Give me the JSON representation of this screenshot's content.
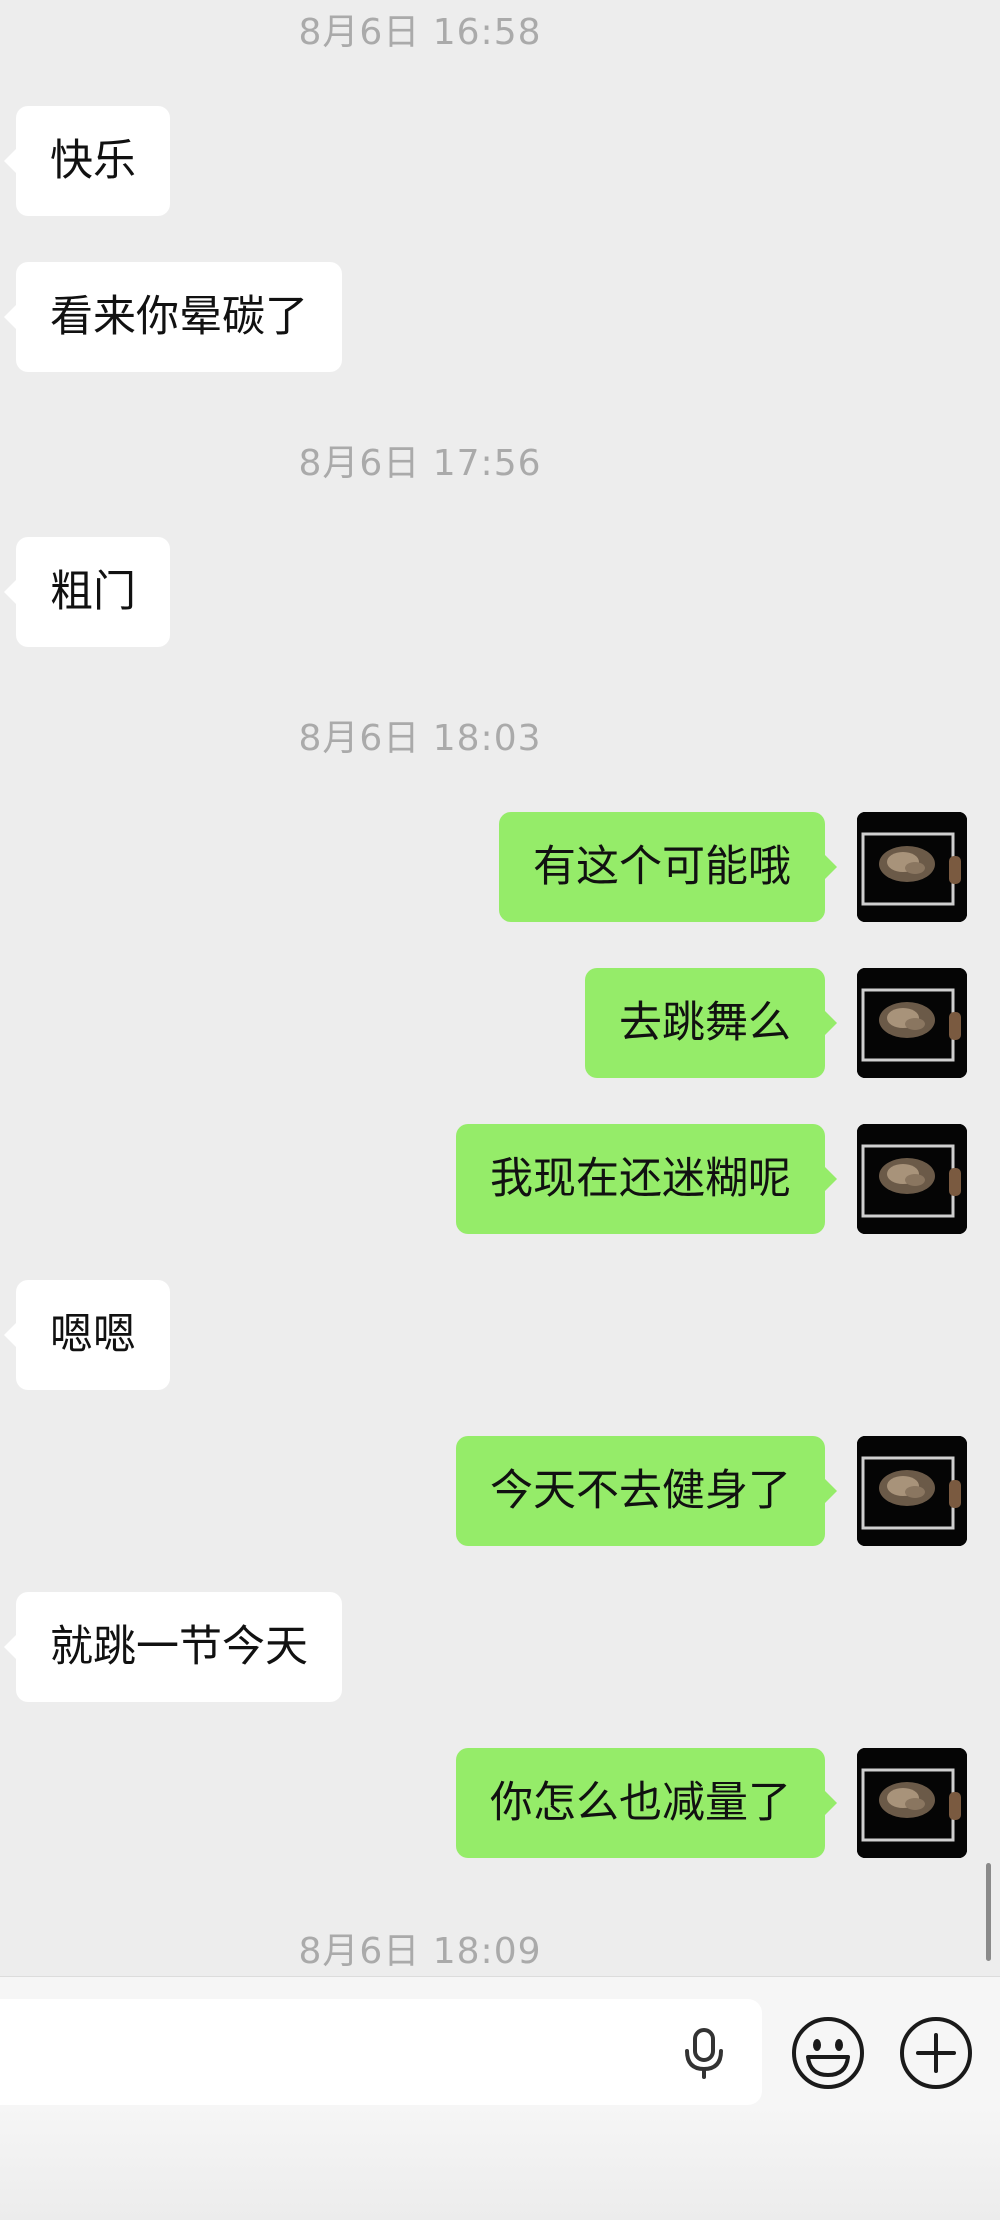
{
  "chat": {
    "timestamps": [
      "8月6日 16:58",
      "8月6日 17:56",
      "8月6日 18:03",
      "8月6日 18:09"
    ],
    "messages": [
      {
        "side": "left",
        "text": "快乐"
      },
      {
        "side": "left",
        "text": "看来你晕碳了"
      },
      {
        "side": "left",
        "text": "粗门"
      },
      {
        "side": "right",
        "text": "有这个可能哦"
      },
      {
        "side": "right",
        "text": "去跳舞么"
      },
      {
        "side": "right",
        "text": "我现在还迷糊呢"
      },
      {
        "side": "left",
        "text": "嗯嗯"
      },
      {
        "side": "right",
        "text": "今天不去健身了"
      },
      {
        "side": "left",
        "text": "就跳一节今天"
      },
      {
        "side": "right",
        "text": "你怎么也减量了"
      }
    ]
  },
  "input_bar": {
    "value": "",
    "icons": [
      "microphone-icon",
      "emoji-icon",
      "plus-icon"
    ]
  },
  "colors": {
    "chat_background": "#ededed",
    "incoming_bubble": "#ffffff",
    "outgoing_bubble": "#95ec69",
    "timestamp_text": "#aaaaaa"
  }
}
